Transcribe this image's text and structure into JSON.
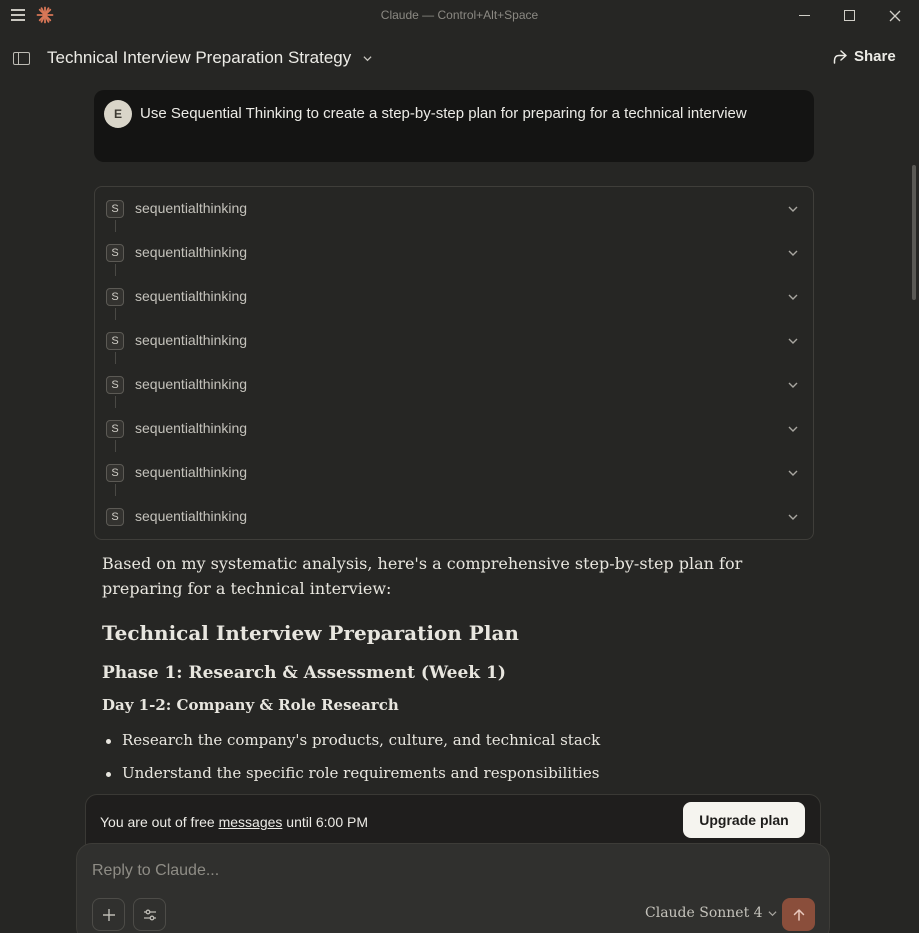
{
  "window": {
    "title": "Claude — Control+Alt+Space"
  },
  "header": {
    "conversation_title": "Technical Interview Preparation Strategy",
    "share_label": "Share"
  },
  "user_message": {
    "avatar_initial": "E",
    "text": "Use Sequential Thinking to create a step-by-step plan for preparing for a technical interview"
  },
  "tool_calls": [
    {
      "icon_letter": "S",
      "name": "sequentialthinking"
    },
    {
      "icon_letter": "S",
      "name": "sequentialthinking"
    },
    {
      "icon_letter": "S",
      "name": "sequentialthinking"
    },
    {
      "icon_letter": "S",
      "name": "sequentialthinking"
    },
    {
      "icon_letter": "S",
      "name": "sequentialthinking"
    },
    {
      "icon_letter": "S",
      "name": "sequentialthinking"
    },
    {
      "icon_letter": "S",
      "name": "sequentialthinking"
    },
    {
      "icon_letter": "S",
      "name": "sequentialthinking"
    }
  ],
  "assistant": {
    "intro": "Based on my systematic analysis, here's a comprehensive step-by-step plan for preparing for a technical interview:",
    "heading": "Technical Interview Preparation Plan",
    "phase": "Phase 1: Research & Assessment (Week 1)",
    "day": "Day 1-2: Company & Role Research",
    "bullets": [
      "Research the company's products, culture, and technical stack",
      "Understand the specific role requirements and responsibilities"
    ]
  },
  "banner": {
    "text_before": "You are out of free ",
    "link": "messages",
    "text_after": " until 6:00 PM",
    "upgrade_label": "Upgrade plan"
  },
  "composer": {
    "placeholder": "Reply to Claude...",
    "model": "Claude Sonnet 4"
  },
  "colors": {
    "background": "#262624",
    "accent": "#d97757",
    "send_button": "#8a4e3b"
  }
}
